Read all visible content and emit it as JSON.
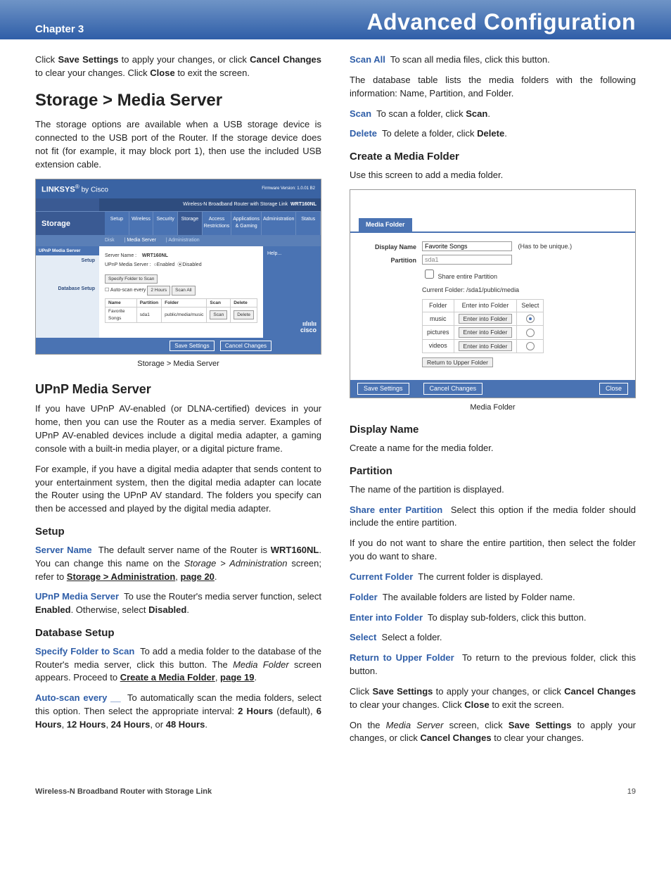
{
  "header": {
    "chapter": "Chapter 3",
    "title": "Advanced Configuration"
  },
  "footer": {
    "product": "Wireless-N Broadband Router with Storage Link",
    "page": "19"
  },
  "left": {
    "intro_html": "Click <b>Save Settings</b> to apply your changes, or click <b>Cancel Changes</b> to clear your changes. Click <b>Close</b> to exit the screen.",
    "h2": "Storage > Media Server",
    "p1": "The storage options are available when a USB storage device is connected to the USB port of the Router. If the storage device does not fit (for example, it may block port 1), then use the included USB extension cable.",
    "caption1": "Storage > Media Server",
    "h3_upnp": "UPnP Media Server",
    "p2": "If you have UPnP AV-enabled (or DLNA-certified) devices in your home, then you can use the Router as a media server. Examples of UPnP AV-enabled devices include a digital media adapter, a gaming console with a built-in media player, or a digital picture frame.",
    "p3": "For example, if you have a digital media adapter that sends content to your entertainment system, then the digital media adapter can locate the Router using the UPnP AV standard. The folders you specify can then be accessed and played by the digital media adapter.",
    "h4_setup": "Setup",
    "srvname_html": "<span class='term'>Server Name</span>&nbsp; The default server name of the Router is <b>WRT160NL</b>. You can change this name on the <i>Storage > Administration</i> screen; refer to <span class='ulink'>Storage > Administration</span>, <span class='ulink'>page 20</span>.",
    "upnp_html": "<span class='term'>UPnP Media Server</span>&nbsp; To use the Router's media server function, select <b>Enabled</b>. Otherwise, select <b>Disabled</b>.",
    "h4_db": "Database Setup",
    "specify_html": "<span class='term'>Specify Folder to Scan</span>&nbsp; To add a media folder to the database of the Router's media server, click this button. The <i>Media Folder</i> screen appears. Proceed to <span class='ulink'>Create a Media Folder</span>, <span class='ulink'>page 19</span>.",
    "autoscan_html": "<span class='term'>Auto-scan every __</span>&nbsp; To automatically scan the media folders, select this option. Then select the appropriate interval: <b>2 Hours</b> (default), <b>6 Hours</b>, <b>12 Hours</b>, <b>24 Hours</b>, or <b>48 Hours</b>."
  },
  "right": {
    "scanall_html": "<span class='term'>Scan All</span>&nbsp; To scan all media files, click this button.",
    "dbtable": "The database table lists the media folders with the following information: Name, Partition, and Folder.",
    "scan_html": "<span class='term'>Scan</span>&nbsp; To scan a folder, click <b>Scan</b>.",
    "delete_html": "<span class='term'>Delete</span>&nbsp; To delete a folder, click <b>Delete</b>.",
    "h4_create": "Create a Media Folder",
    "create_p": "Use this screen to add a media folder.",
    "caption2": "Media Folder",
    "h4_dn": "Display Name",
    "dn_p": "Create a name for the media folder.",
    "h4_part": "Partition",
    "part_p": "The name of the partition is displayed.",
    "share_html": "<span class='term'>Share enter Partition</span>&nbsp; Select this option if the media folder should include the entire partition.",
    "ifnot": "If you do not want to share the entire partition, then select the folder you do want to share.",
    "cf_html": "<span class='term'>Current Folder</span>&nbsp; The current folder is displayed.",
    "folder_html": "<span class='term'>Folder</span>&nbsp; The available folders are listed by Folder name.",
    "enter_html": "<span class='term'>Enter into Folder</span>&nbsp; To display sub-folders, click this button.",
    "select_html": "<span class='term'>Select</span>&nbsp; Select a folder.",
    "return_html": "<span class='term'>Return to Upper Folder</span>&nbsp; To return to the previous folder, click this button.",
    "save1_html": "Click <b>Save Settings</b> to apply your changes, or click <b>Cancel Changes</b> to clear your changes. Click <b>Close</b> to exit the screen.",
    "save2_html": "On the <i>Media Server</i> screen, click <b>Save Settings</b> to apply your changes, or click <b>Cancel Changes</b> to clear your changes."
  },
  "ss1": {
    "brand": "LINKSYS",
    "by": "by Cisco",
    "fw": "Firmware Version: 1.0.01 B2",
    "model_line": "Wireless-N Broadband Router with Storage Link",
    "model": "WRT160NL",
    "section": "Storage",
    "tabs": [
      "Setup",
      "Wireless",
      "Security",
      "Storage",
      "Access Restrictions",
      "Applications & Gaming",
      "Administration",
      "Status"
    ],
    "subtabs": [
      "Disk",
      "Media Server",
      "Administration"
    ],
    "side_hdr": "UPnP Media Server",
    "side_items": [
      "Setup",
      "",
      "Database Setup"
    ],
    "srv_label": "Server Name :",
    "srv_val": "WRT160NL",
    "upnp_label": "UPnP Media Server :",
    "enabled": "Enabled",
    "disabled": "Disabled",
    "specify_btn": "Specify Folder to Scan",
    "autoscan": "Auto-scan every",
    "interval": "2 Hours",
    "scanall": "Scan All",
    "th": [
      "Name",
      "Partition",
      "Folder",
      "Scan",
      "Delete"
    ],
    "row": [
      "Favorite Songs",
      "sda1",
      "public/media/music",
      "Scan",
      "Delete"
    ],
    "help": "Help...",
    "cisco": "cisco",
    "save": "Save Settings",
    "cancel": "Cancel Changes"
  },
  "ss2": {
    "tab": "Media Folder",
    "dn_label": "Display Name",
    "dn_val": "Favorite Songs",
    "dn_hint": "(Has to be unique.)",
    "part_label": "Partition",
    "part_val": "sda1",
    "share_cb": "Share entire Partition",
    "cf": "Current Folder: /sda1/public/media",
    "th": [
      "Folder",
      "Enter into Folder",
      "Select"
    ],
    "rows": [
      {
        "name": "music",
        "sel": true
      },
      {
        "name": "pictures",
        "sel": false
      },
      {
        "name": "videos",
        "sel": false
      }
    ],
    "enter_btn": "Enter into Folder",
    "return_btn": "Return to Upper Folder",
    "save": "Save Settings",
    "cancel": "Cancel Changes",
    "close": "Close"
  }
}
